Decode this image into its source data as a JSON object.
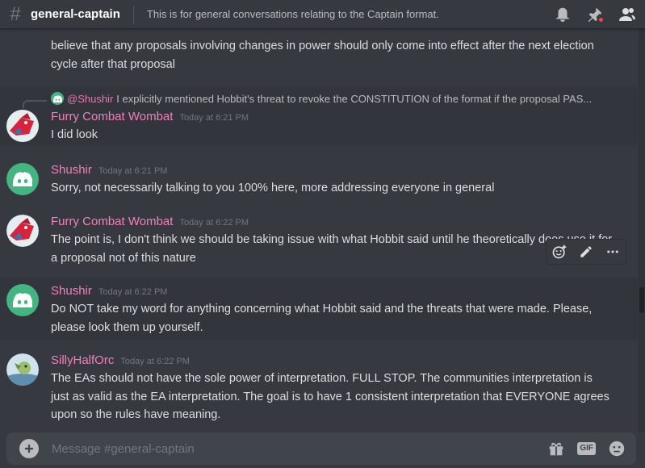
{
  "header": {
    "channel_name": "general-captain",
    "topic": "This is for general conversations relating to the Captain format."
  },
  "icons": {
    "hash": "hash-icon",
    "bell": "bell-icon",
    "pin": "pin-icon",
    "members": "members-icon",
    "discord": "discord-logo-icon"
  },
  "colors": {
    "background": "#36393f",
    "username_pink": "#f47fbd",
    "discord_green": "#43b581",
    "timestamp": "#72767d"
  },
  "messages": {
    "continued": {
      "lines": "believe that any proposals involving changes in power should only come into effect after the next election cycle after that proposal"
    },
    "m1": {
      "reply_mention": "@Shushir",
      "reply_text": "I explicitly mentioned Hobbit's threat to revoke the CONSTITUTION of the format if the proposal PAS...",
      "author": "Furry Combat Wombat",
      "time": "Today at 6:21 PM",
      "text": "I did look"
    },
    "m2": {
      "author": "Shushir",
      "time": "Today at 6:21 PM",
      "text": "Sorry, not necessarily talking to you 100% here, more addressing everyone in general"
    },
    "m3": {
      "author": "Furry Combat Wombat",
      "time": "Today at 6:22 PM",
      "text": "The point is, I don't think we should be taking issue with what Hobbit said until he theoretically does use it for a proposal not of this nature"
    },
    "m4": {
      "author": "Shushir",
      "time": "Today at 6:22 PM",
      "text": "Do NOT take my word for anything concerning what Hobbit said and the threats that were made. Please, please look them up yourself."
    },
    "m5": {
      "author": "SillyHalfOrc",
      "time": "Today at 6:22 PM",
      "text": "The EAs should not have the sole power of interpretation. FULL STOP. The communities interpretation is just as valid as the EA interpretation.  The goal is to have 1 consistent interpretation that EVERYONE agrees upon so the rules have meaning."
    }
  },
  "composer": {
    "placeholder": "Message #general-captain",
    "gif_label": "GIF"
  }
}
